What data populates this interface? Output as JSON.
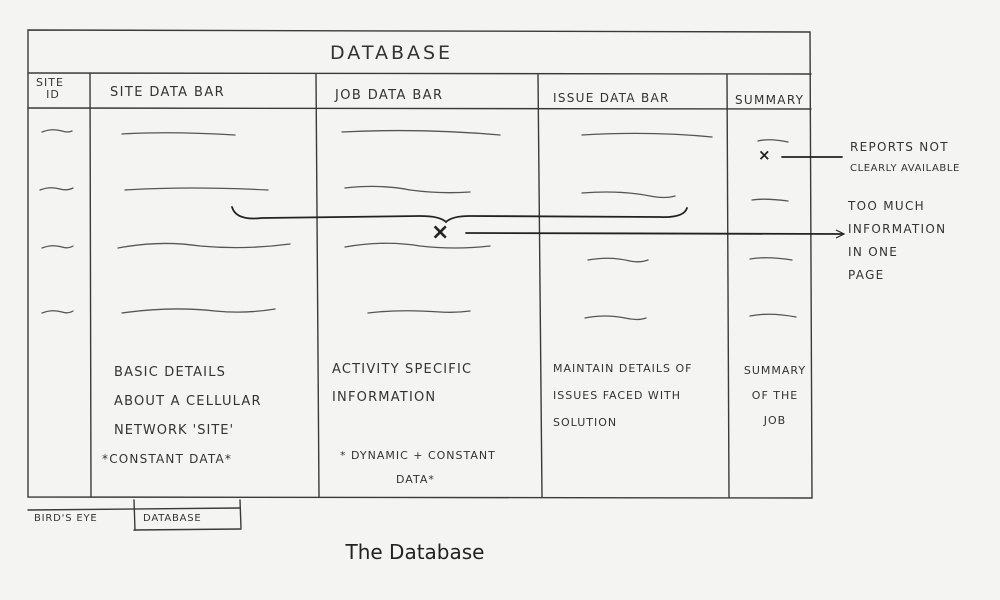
{
  "window": {
    "title": "DATABASE"
  },
  "columns": [
    {
      "id": "site-id",
      "label_lines": [
        "SITE",
        "ID"
      ]
    },
    {
      "id": "site-data",
      "label": "SITE DATA BAR"
    },
    {
      "id": "job-data",
      "label": "JOB DATA BAR"
    },
    {
      "id": "issue-data",
      "label": "ISSUE DATA BAR"
    },
    {
      "id": "summary",
      "label": "SUMMARY"
    }
  ],
  "descriptions": {
    "site_data": [
      "BASIC DETAILS",
      "ABOUT A CELLULAR",
      "NETWORK 'SITE'",
      "*CONSTANT DATA*"
    ],
    "job_data": [
      "ACTIVITY SPECIFIC",
      "INFORMATION",
      "* DYNAMIC + CONSTANT",
      "DATA*"
    ],
    "issue_data": [
      "MAINTAIN DETAILS OF",
      "ISSUES FACED WITH",
      "SOLUTION"
    ],
    "summary": [
      "SUMMARY",
      "OF THE",
      "JOB"
    ]
  },
  "annotations": [
    {
      "id": "reports",
      "lines": [
        "REPORTS NOT",
        "CLEARLY AVAILABLE"
      ]
    },
    {
      "id": "too-much",
      "lines": [
        "TOO MUCH",
        "INFORMATION",
        "IN ONE",
        "PAGE"
      ]
    }
  ],
  "tabs": [
    "BIRD'S EYE",
    "DATABASE"
  ],
  "caption": "The Database",
  "colors": {
    "ink": "#333333",
    "paper": "#f4f4f3"
  }
}
